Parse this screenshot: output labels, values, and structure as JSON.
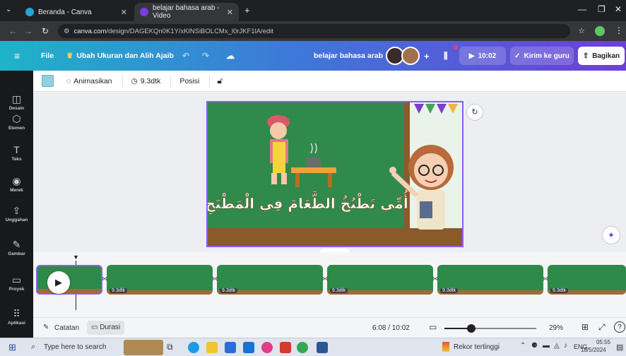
{
  "browser": {
    "tabs": [
      {
        "title": "Beranda - Canva",
        "active": false,
        "favicon_color": "#23a6d5"
      },
      {
        "title": "belajar bahasa arab - Video",
        "active": true,
        "favicon_color": "#7a3ce0"
      }
    ],
    "new_tab": "+",
    "url_host": "canva.com",
    "url_path": "/design/DAGEKQn0K1Y/xKlNSiBOLCMx_l0rJKF1lA/edit"
  },
  "canva_bar": {
    "file": "File",
    "resize": "Ubah Ukuran dan Alih Ajaib",
    "design_title": "belajar bahasa arab",
    "play_time": "10:02",
    "send_teacher": "Kirim ke guru",
    "share": "Bagikan",
    "plus": "+"
  },
  "sidebar": {
    "items": [
      {
        "label": "Desain",
        "icon": "layout-icon",
        "glyph": "◫"
      },
      {
        "label": "Elemen",
        "icon": "shapes-icon",
        "glyph": "⬡"
      },
      {
        "label": "Teks",
        "icon": "text-icon",
        "glyph": "T"
      },
      {
        "label": "Merek",
        "icon": "brand-icon",
        "glyph": "◉"
      },
      {
        "label": "Unggahan",
        "icon": "upload-icon",
        "glyph": "⇪"
      },
      {
        "label": "Gambar",
        "icon": "draw-icon",
        "glyph": "✎"
      },
      {
        "label": "Proyek",
        "icon": "folder-icon",
        "glyph": "▭"
      },
      {
        "label": "Aplikasi",
        "icon": "apps-icon",
        "glyph": "⠿"
      }
    ]
  },
  "context_bar": {
    "animate": "Animasikan",
    "duration": "9.3dtk",
    "position": "Posisi"
  },
  "slide": {
    "arabic_text": "أُمِّي تَطْبُخُ الطَّعَامَ فِي الْمَطْبَخِ"
  },
  "timeline": {
    "clip_duration_label": "9.3dtk",
    "clip_count": 6
  },
  "footer": {
    "notes": "Catatan",
    "duration": "Durasi",
    "time": "6:08 / 10:02",
    "zoom": "29%",
    "zoom_level": 0.29,
    "help": "?"
  },
  "taskbar": {
    "search_placeholder": "Type here to search",
    "weather": "Rekor tertinggi",
    "lang": "ENG",
    "time": "05:55",
    "date": "18/5/2024"
  },
  "colors": {
    "accent": "#8b5cf6",
    "board_green": "#2b7a43",
    "canva_gradient_start": "#1fb3c9",
    "canva_gradient_end": "#6d3fd6"
  }
}
